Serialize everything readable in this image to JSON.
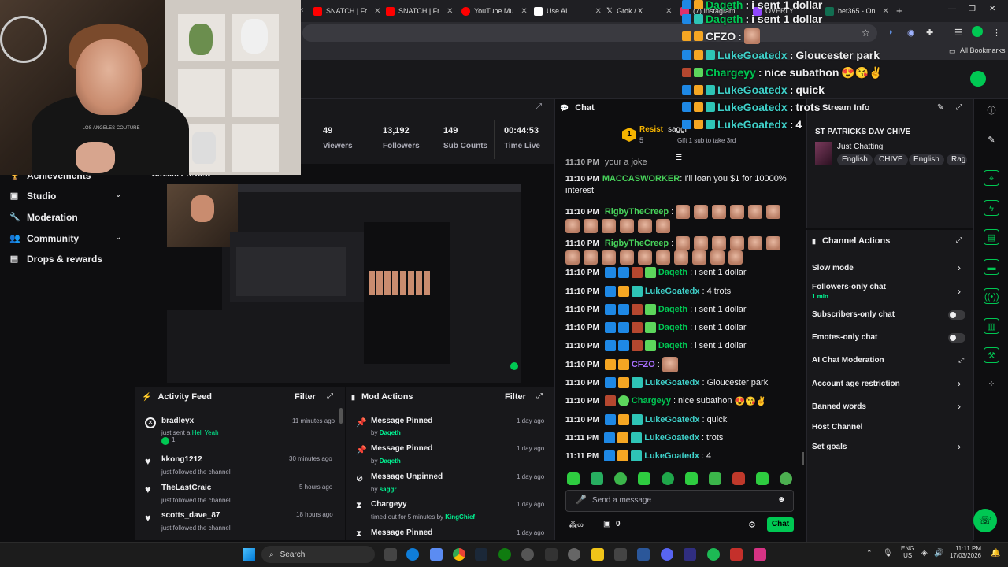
{
  "browser": {
    "tabs": [
      {
        "label": "SNATCH | Fr",
        "color": "#ff0000"
      },
      {
        "label": "SNATCH | Fr",
        "color": "#ff0000"
      },
      {
        "label": "YouTube Mu",
        "color": "#ff0000"
      },
      {
        "label": "Use AI",
        "color": "#ffffff"
      },
      {
        "label": "Grok / X",
        "color": "#ffffff"
      },
      {
        "label": "(7) Instagram",
        "color": "#e1306c"
      },
      {
        "label": "OVERLY",
        "color": "#9147ff"
      },
      {
        "label": "bet365 - On",
        "color": "#126e51"
      }
    ],
    "bookmarks_label": "All Bookmarks"
  },
  "left_nav": {
    "items": [
      {
        "label": "Achievements"
      },
      {
        "label": "Studio"
      },
      {
        "label": "Moderation"
      },
      {
        "label": "Community"
      },
      {
        "label": "Drops & rewards"
      }
    ]
  },
  "stats": {
    "viewers": {
      "value": "49",
      "label": "Viewers"
    },
    "followers": {
      "value": "13,192",
      "label": "Followers"
    },
    "sub_counts": {
      "value": "149",
      "label": "Sub Counts"
    },
    "time_live": {
      "value": "00:44:53",
      "label": "Time Live"
    }
  },
  "preview": {
    "title": "Stream Preview"
  },
  "activity_feed": {
    "title": "Activity Feed",
    "filter": "Filter",
    "items": [
      {
        "name": "bradleyx",
        "sub": "just sent a",
        "sub_highlight": "Hell Yeah",
        "count": "1",
        "time": "11 minutes ago"
      },
      {
        "name": "kkong1212",
        "sub": "just followed the channel",
        "time": "30 minutes ago"
      },
      {
        "name": "TheLastCraic",
        "sub": "just followed the channel",
        "time": "5 hours ago"
      },
      {
        "name": "scotts_dave_87",
        "sub": "just followed the channel",
        "time": "18 hours ago"
      }
    ]
  },
  "mod_actions": {
    "title": "Mod Actions",
    "filter": "Filter",
    "items": [
      {
        "action": "Message Pinned",
        "by": "by",
        "who": "Daqeth",
        "time": "1 day ago"
      },
      {
        "action": "Message Pinned",
        "by": "by",
        "who": "Daqeth",
        "time": "1 day ago"
      },
      {
        "action": "Message Unpinned",
        "by": "by",
        "who": "saggr",
        "time": "1 day ago"
      },
      {
        "action": "Chargeyy",
        "by": "timed out for 5 minutes by",
        "who": "KingChief",
        "time": "1 day ago"
      },
      {
        "action": "Message Pinned",
        "by": "",
        "who": "",
        "time": "1 day ago"
      }
    ]
  },
  "chat": {
    "title": "Chat",
    "goal": {
      "rank": "1",
      "name": "Resist",
      "count": "5",
      "other": "saggr",
      "sub_prompt": "Gift 1 sub to take 3rd"
    },
    "messages": [
      {
        "time": "11:10 PM",
        "user": "MACCASWORKER",
        "text": "I'll loan you $1 for 10000% interest"
      },
      {
        "time": "11:10 PM",
        "user": "RigbyTheCreep",
        "text": ""
      },
      {
        "time": "11:10 PM",
        "user": "RigbyTheCreep",
        "text": ""
      },
      {
        "time": "11:10 PM",
        "user": "Daqeth",
        "text": "i sent 1 dollar"
      },
      {
        "time": "11:10 PM",
        "user": "LukeGoatedx",
        "text": "4 trots"
      },
      {
        "time": "11:10 PM",
        "user": "Daqeth",
        "text": "i sent 1 dollar"
      },
      {
        "time": "11:10 PM",
        "user": "Daqeth",
        "text": "i sent 1 dollar"
      },
      {
        "time": "11:10 PM",
        "user": "Daqeth",
        "text": "i sent 1 dollar"
      },
      {
        "time": "11:10 PM",
        "user": "CFZO",
        "text": ""
      },
      {
        "time": "11:10 PM",
        "user": "LukeGoatedx",
        "text": "Gloucester park"
      },
      {
        "time": "11:10 PM",
        "user": "Chargeyy",
        "text": "nice subathon"
      },
      {
        "time": "11:10 PM",
        "user": "LukeGoatedx",
        "text": "quick"
      },
      {
        "time": "11:11 PM",
        "user": "LukeGoatedx",
        "text": "trots"
      },
      {
        "time": "11:11 PM",
        "user": "LukeGoatedx",
        "text": "4"
      }
    ],
    "input_placeholder": "Send a message",
    "points": "0",
    "chat_button": "Chat"
  },
  "stream_info": {
    "title": "Stream Info",
    "stream_title": "ST PATRICKS DAY CHIVE",
    "category": "Just Chatting",
    "tags": [
      "English",
      "CHIVE",
      "English",
      "Rag"
    ]
  },
  "channel_actions": {
    "title": "Channel Actions",
    "items": [
      {
        "label": "Slow mode"
      },
      {
        "label": "Followers-only chat",
        "sub": "1 min"
      },
      {
        "label": "Subscribers-only chat"
      },
      {
        "label": "Emotes-only chat"
      },
      {
        "label": "AI Chat Moderation"
      },
      {
        "label": "Account age restriction"
      },
      {
        "label": "Banned words"
      },
      {
        "label": "Host Channel"
      },
      {
        "label": "Set goals"
      }
    ]
  },
  "overlay_chat": [
    {
      "user": "Daqeth",
      "text": "i sent 1 dollar"
    },
    {
      "user": "Daqeth",
      "text": "i sent 1 dollar"
    },
    {
      "user": "CFZO",
      "text": ""
    },
    {
      "user": "LukeGoatedx",
      "text": "Gloucester park"
    },
    {
      "user": "Chargeyy",
      "text": "nice subathon"
    },
    {
      "user": "LukeGoatedx",
      "text": "quick"
    },
    {
      "user": "LukeGoatedx",
      "text": "trots"
    },
    {
      "user": "LukeGoatedx",
      "text": "4"
    }
  ],
  "webcam_shirt_text": "LOS ANGELES COUTURE",
  "taskbar": {
    "search": "Search",
    "lang": "ENG",
    "region": "US",
    "time": "11:11 PM",
    "date": "17/03/2026"
  },
  "colors": {
    "accent_green": "#00c853",
    "brand_purple": "#9147ff",
    "bg": "#0e0e10",
    "panel": "#18181b"
  }
}
